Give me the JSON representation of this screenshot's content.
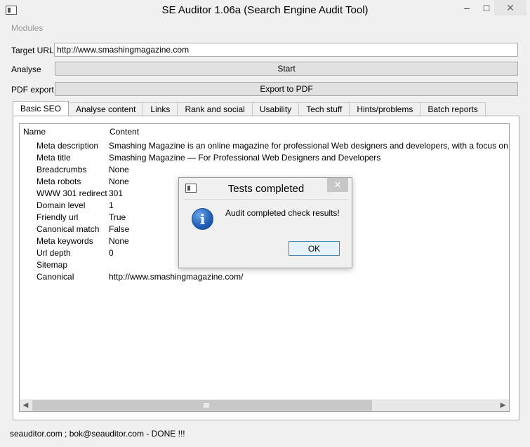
{
  "window": {
    "title": "SE Auditor 1.06a (Search Engine Audit Tool)",
    "icon": "app-window-icon",
    "controls": {
      "minimize": "–",
      "maximize": "□",
      "close": "✕"
    }
  },
  "menu": {
    "modules": "Modules"
  },
  "form": {
    "url_label": "Target URL",
    "url_value": "http://www.smashingmagazine.com",
    "analyse_label": "Analyse",
    "start_button": "Start",
    "pdf_label": "PDF export",
    "pdf_button": "Export to PDF"
  },
  "tabs": [
    {
      "label": "Basic SEO",
      "active": true
    },
    {
      "label": "Analyse content"
    },
    {
      "label": "Links"
    },
    {
      "label": "Rank and social"
    },
    {
      "label": "Usability"
    },
    {
      "label": "Tech stuff"
    },
    {
      "label": "Hints/problems"
    },
    {
      "label": "Batch reports"
    }
  ],
  "table": {
    "columns": [
      "Name",
      "Content"
    ],
    "rows": [
      {
        "name": "Meta description",
        "value": "Smashing Magazine is an online magazine for professional Web designers and developers, with a focus on us"
      },
      {
        "name": "Meta title",
        "value": "Smashing Magazine — For Professional Web Designers and Developers"
      },
      {
        "name": "Breadcrumbs",
        "value": "None"
      },
      {
        "name": "Meta robots",
        "value": "None"
      },
      {
        "name": "WWW 301 redirect",
        "value": "301"
      },
      {
        "name": "Domain level",
        "value": "1"
      },
      {
        "name": "Friendly url",
        "value": "True"
      },
      {
        "name": "Canonical match",
        "value": "False"
      },
      {
        "name": "Meta keywords",
        "value": "None"
      },
      {
        "name": "Url depth",
        "value": "0"
      },
      {
        "name": "Sitemap",
        "value": ""
      },
      {
        "name": "Canonical",
        "value": "http://www.smashingmagazine.com/"
      }
    ],
    "scroll": {
      "left": "◀",
      "right": "▶"
    }
  },
  "status": "seauditor.com ; bok@seauditor.com - DONE !!!",
  "dialog": {
    "title": "Tests completed",
    "close": "✕",
    "icon": "info-icon",
    "icon_glyph": "i",
    "message": "Audit completed check results!",
    "ok_button": "OK"
  },
  "colors": {
    "window_bg": "#f0f0f0",
    "ok_border": "#3c7fb1",
    "info_blue": "#1f5fb5"
  }
}
